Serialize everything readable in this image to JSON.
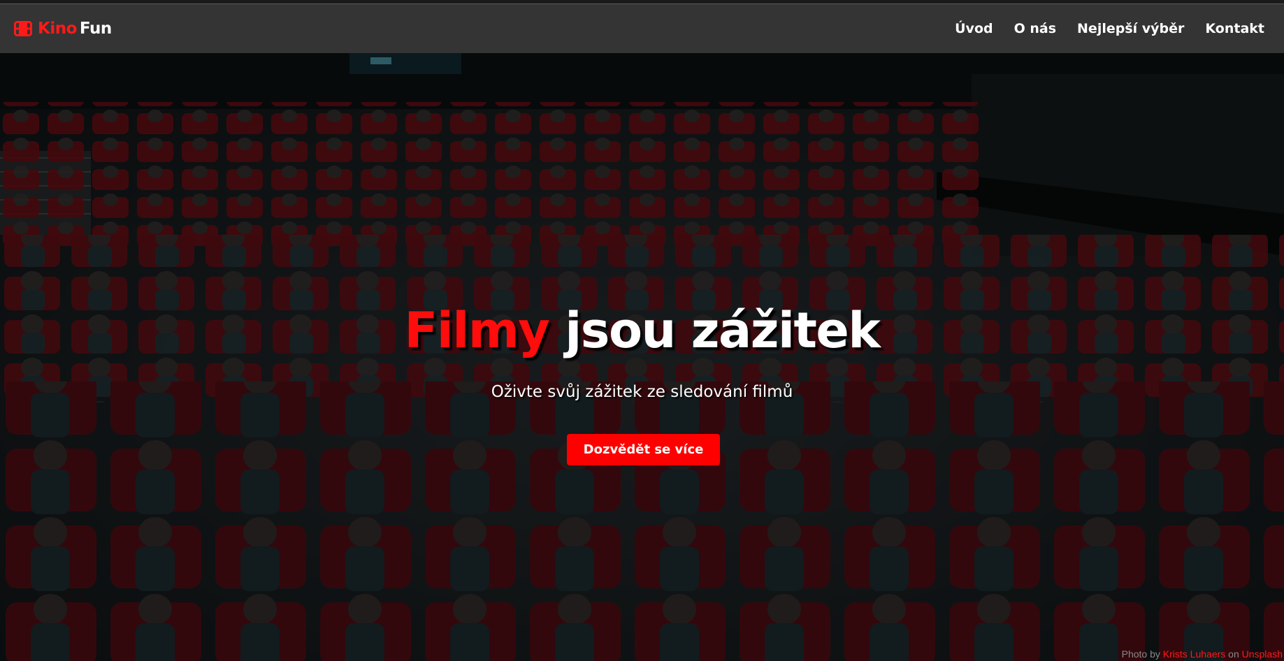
{
  "brand": {
    "kino": "Kino",
    "fun": "Fun",
    "icon": "film-icon",
    "accent": "#ff1a1a"
  },
  "nav": {
    "items": [
      "Úvod",
      "O nás",
      "Nejlepší výběr",
      "Kontakt"
    ]
  },
  "hero": {
    "title_accent": "Filmy",
    "title_rest": "jsou zážitek",
    "subtitle": "Oživte svůj zážitek ze sledování filmů",
    "button": "Dozvědět se více",
    "button_color": "#ff0000"
  },
  "credit": {
    "prefix": "Photo by",
    "author": "Krists Luhaers",
    "on": "on",
    "site": "Unsplash"
  }
}
